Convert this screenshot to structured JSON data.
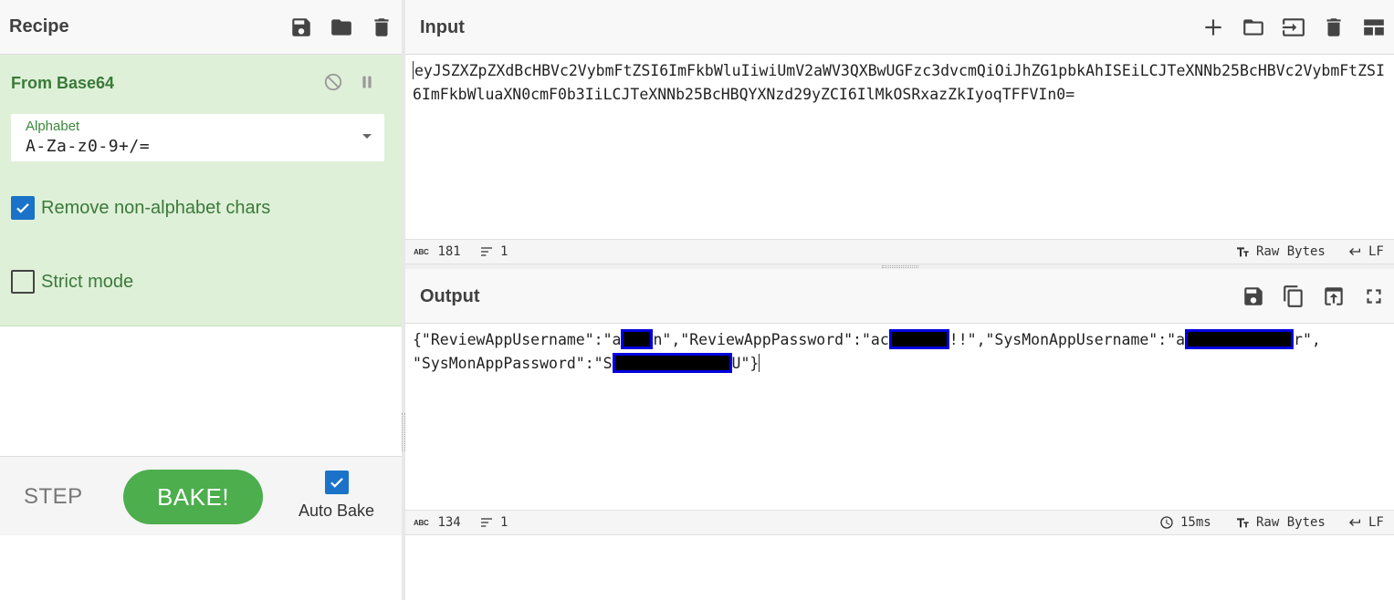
{
  "recipe": {
    "title": "Recipe",
    "icons": [
      "save-icon",
      "folder-icon",
      "trash-icon"
    ],
    "operation": {
      "name": "From Base64",
      "alphabet_label": "Alphabet",
      "alphabet_value": "A-Za-z0-9+/=",
      "remove_non_alphabet_label": "Remove non-alphabet chars",
      "remove_non_alphabet_checked": true,
      "strict_mode_label": "Strict mode",
      "strict_mode_checked": false
    },
    "step_label": "STEP",
    "bake_label": "BAKE!",
    "auto_bake_label": "Auto Bake",
    "auto_bake_checked": true
  },
  "input": {
    "title": "Input",
    "text": "eyJSZXZpZXdBcHBVc2VybmFtZSI6ImFkbWluIiwiUmV2aWV3QXBwUGFzc3dvcmQiOiJhZG1pbkAhISEiLCJTeXNNb25BcHBVc2VybmFtZSI6ImFkbWluaXN0cmF0b3IiLCJTeXNNb25BcHBQYXNzd29yZCI6IlMkOSRxazZkIyoqTFFVIn0=",
    "status": {
      "length": "181",
      "lines": "1",
      "encoding": "Raw Bytes",
      "eol": "LF"
    }
  },
  "output": {
    "title": "Output",
    "parts": {
      "p1": "{\"ReviewAppUsername\":\"a",
      "p2": "n\",\"ReviewAppPassword\":\"ac",
      "p3": "!!\",\"SysMonAppUsername\":\"a",
      "p4": "r\",",
      "p5": "\"SysMonAppPassword\":\"S",
      "p6": "U\"}"
    },
    "status": {
      "length": "134",
      "lines": "1",
      "time": "15ms",
      "encoding": "Raw Bytes",
      "eol": "LF"
    }
  },
  "colors": {
    "recipe_bg": "#dff0d8",
    "bake_button": "#4cae4c",
    "checkbox": "#1a73c8",
    "redaction_border": "#0000e0"
  }
}
